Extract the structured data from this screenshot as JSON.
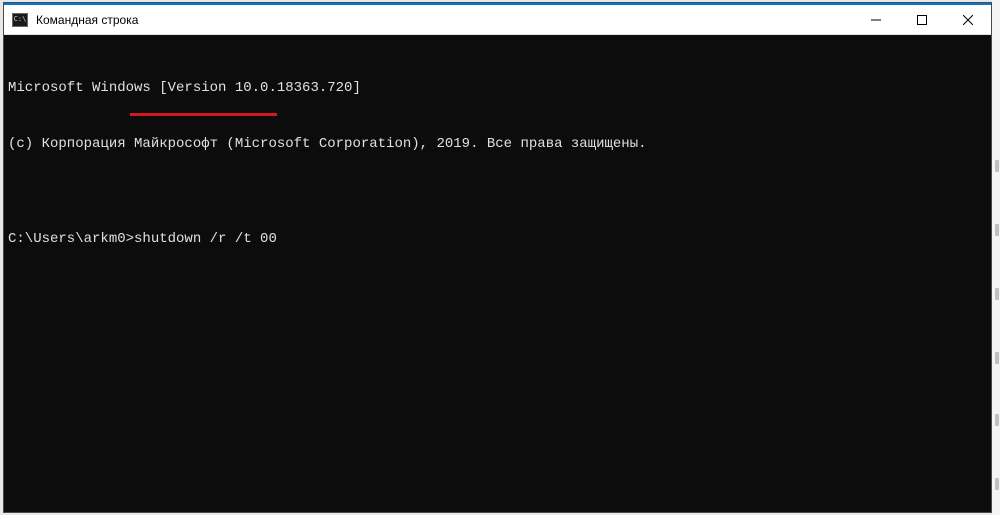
{
  "window": {
    "title": "Командная строка",
    "icon_label": "C:\\"
  },
  "terminal": {
    "lines": [
      "Microsoft Windows [Version 10.0.18363.720]",
      "(c) Корпорация Майкрософт (Microsoft Corporation), 2019. Все права защищены.",
      "",
      "C:\\Users\\arkm0>shutdown /r /t 00"
    ],
    "prompt": "C:\\Users\\arkm0>",
    "command": "shutdown /r /t 00"
  },
  "annotation": {
    "color": "#d4181f",
    "underlined_text": "shutdown /r /t 00"
  }
}
